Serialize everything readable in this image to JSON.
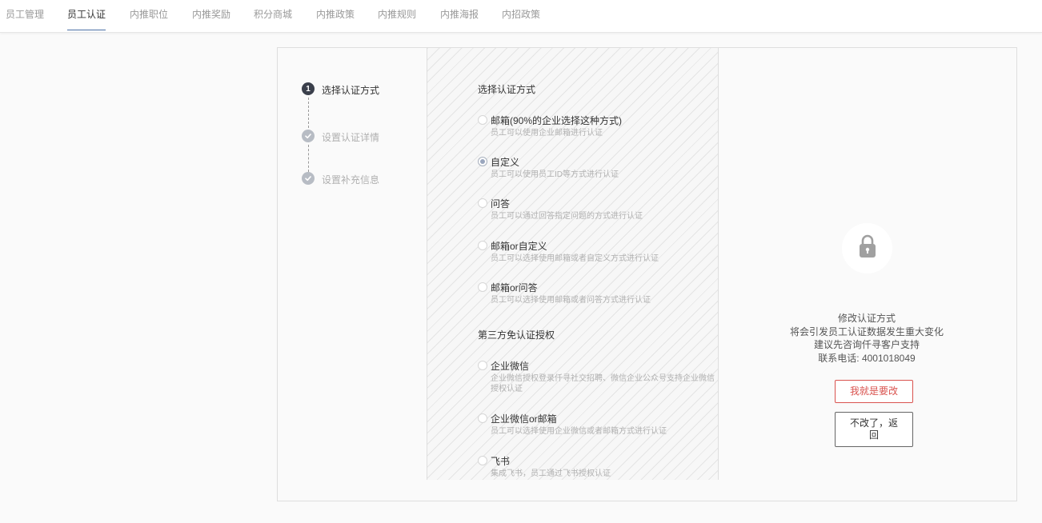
{
  "tabs": [
    {
      "label": "员工管理",
      "active": false
    },
    {
      "label": "员工认证",
      "active": true
    },
    {
      "label": "内推职位",
      "active": false
    },
    {
      "label": "内推奖励",
      "active": false
    },
    {
      "label": "积分商城",
      "active": false
    },
    {
      "label": "内推政策",
      "active": false
    },
    {
      "label": "内推规则",
      "active": false
    },
    {
      "label": "内推海报",
      "active": false
    },
    {
      "label": "内招政策",
      "active": false
    }
  ],
  "steps": [
    {
      "number": "1",
      "label": "选择认证方式",
      "status": "active"
    },
    {
      "label": "设置认证详情",
      "status": "done"
    },
    {
      "label": "设置补充信息",
      "status": "done"
    }
  ],
  "auth_section": {
    "title": "选择认证方式",
    "options": [
      {
        "title": "邮箱(90%的企业选择这种方式)",
        "desc": "员工可以使用企业邮箱进行认证",
        "checked": false
      },
      {
        "title": "自定义",
        "desc": "员工可以使用员工ID等方式进行认证",
        "checked": true
      },
      {
        "title": "问答",
        "desc": "员工可以通过回答指定问题的方式进行认证",
        "checked": false
      },
      {
        "title": "邮箱or自定义",
        "desc": "员工可以选择使用邮箱或者自定义方式进行认证",
        "checked": false
      },
      {
        "title": "邮箱or问答",
        "desc": "员工可以选择使用邮箱或者问答方式进行认证",
        "checked": false
      }
    ]
  },
  "third_party_section": {
    "title": "第三方免认证授权",
    "options": [
      {
        "title": "企业微信",
        "desc": "企业微信授权登录仟寻社交招聘、微信企业公众号支持企业微信授权认证",
        "checked": false
      },
      {
        "title": "企业微信or邮箱",
        "desc": "员工可以选择使用企业微信或者邮箱方式进行认证",
        "checked": false
      },
      {
        "title": "飞书",
        "desc": "集成飞书，员工通过飞书授权认证",
        "checked": false
      }
    ]
  },
  "notice": {
    "line1": "修改认证方式",
    "line2": "将会引发员工认证数据发生重大变化",
    "line3": "建议先咨询仟寻客户支持",
    "line4": "联系电话: 4001018049"
  },
  "buttons": {
    "confirm": "我就是要改",
    "back": "不改了，返回"
  },
  "colors": {
    "accent_danger": "#d9534f",
    "step_active": "#3a3f4b",
    "step_done": "#b7bcc4"
  }
}
